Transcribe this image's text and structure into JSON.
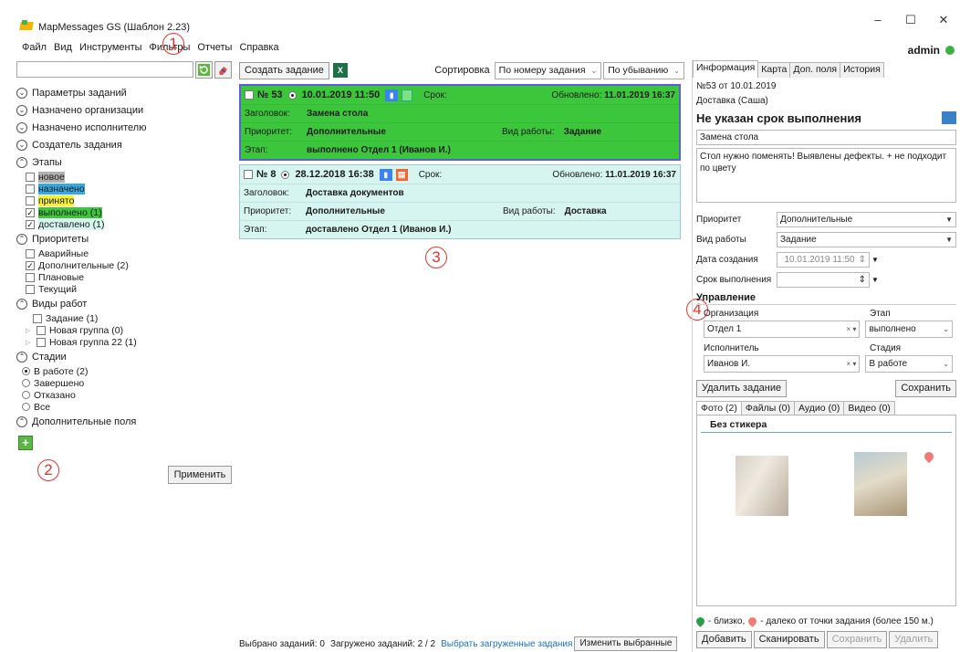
{
  "window": {
    "title": "MapMessages GS (Шаблон 2.23)",
    "min_glyph": "–",
    "max_glyph": "☐",
    "close_glyph": "✕"
  },
  "menu": [
    "Файл",
    "Вид",
    "Инструменты",
    "Фильтры",
    "Отчеты",
    "Справка"
  ],
  "user": {
    "name": "admin",
    "status_color": "#3cb043"
  },
  "markers": {
    "m1": "1",
    "m2": "2",
    "m3": "3",
    "m4": "4",
    "color": "#e0342b"
  },
  "left": {
    "search": {
      "value": "",
      "placeholder": ""
    },
    "sections": {
      "params": "Параметры заданий",
      "org": "Назначено организации",
      "executor": "Назначено исполнителю",
      "creator": "Создатель задания",
      "stages": "Этапы",
      "priorities": "Приоритеты",
      "work_types": "Виды работ",
      "phases": "Стадии",
      "extra": "Дополнительные поля"
    },
    "stages": [
      {
        "label": "новое",
        "checked": false,
        "highlight": "#b0b0b0"
      },
      {
        "label": "назначено",
        "checked": false,
        "highlight": "#36a9e1"
      },
      {
        "label": "принято",
        "checked": false,
        "highlight": "#f5f032"
      },
      {
        "label": "выполнено (1)",
        "checked": true,
        "highlight": "#3cc63c"
      },
      {
        "label": "доставлено (1)",
        "checked": true,
        "highlight": "#d6f5f0"
      }
    ],
    "priorities": [
      {
        "label": "Аварийные",
        "checked": false
      },
      {
        "label": "Дополнительные (2)",
        "checked": true
      },
      {
        "label": "Плановые",
        "checked": false
      },
      {
        "label": "Текущий",
        "checked": false
      }
    ],
    "work_types": [
      {
        "label": "Задание (1)"
      },
      {
        "label": "Новая группа (0)"
      },
      {
        "label": "Новая группа 22 (1)"
      }
    ],
    "phases": [
      {
        "label": "В работе (2)",
        "selected": true
      },
      {
        "label": "Завершено",
        "selected": false
      },
      {
        "label": "Отказано",
        "selected": false
      },
      {
        "label": "Все",
        "selected": false
      }
    ],
    "apply_label": "Применить"
  },
  "middle": {
    "create_label": "Создать задание",
    "excel_label": "X",
    "sort_label": "Сортировка",
    "sort_by": "По номеру задания",
    "sort_dir": "По убыванию",
    "cards": [
      {
        "num": "№ 53",
        "date": "10.01.2019 11:50",
        "srok": "Срок:",
        "updated_label": "Обновлено:",
        "updated": "11.01.2019 16:37",
        "title_label": "Заголовок:",
        "title": "Замена стола",
        "priority_label": "Приоритет:",
        "priority": "Дополнительные",
        "work_label": "Вид работы:",
        "work": "Задание",
        "stage_label": "Этап:",
        "stage": "выполнено Отдел 1 (Иванов И.)"
      },
      {
        "num": "№ 8",
        "date": "28.12.2018 16:38",
        "srok": "Срок:",
        "updated_label": "Обновлено:",
        "updated": "11.01.2019 16:37",
        "title_label": "Заголовок:",
        "title": "Доставка документов",
        "priority_label": "Приоритет:",
        "priority": "Дополнительные",
        "work_label": "Вид работы:",
        "work": "Доставка",
        "stage_label": "Этап:",
        "stage": "доставлено Отдел 1 (Иванов И.)"
      }
    ],
    "status": {
      "selected": "Выбрано заданий: 0",
      "loaded": "Загружено заданий: 2 / 2",
      "select_link": "Выбрать загруженные задания",
      "change_btn": "Изменить выбранные"
    }
  },
  "right": {
    "tabs": [
      "Информация",
      "Карта",
      "Доп. поля",
      "История"
    ],
    "task_line": "№53 от 10.01.2019",
    "delivery": "Доставка (Саша)",
    "headline": "Не указан срок выполнения",
    "title_value": "Замена стола",
    "description": "Стол нужно поменять! Выявлены дефекты. + не подходит по цвету",
    "priority_label": "Приоритет",
    "priority_value": "Дополнительные",
    "work_label": "Вид работы",
    "work_value": "Задание",
    "created_label": "Дата создания",
    "created_value": "10.01.2019 11:50",
    "due_label": "Срок выполнения",
    "due_value": "",
    "mgmt_title": "Управление",
    "org_label": "Организация",
    "org_value": "Отдел 1",
    "stage_label": "Этап",
    "stage_value": "выполнено",
    "exec_label": "Исполнитель",
    "exec_value": "Иванов И.",
    "phase_label": "Стадия",
    "phase_value": "В работе",
    "delete_label": "Удалить задание",
    "save_label": "Сохранить",
    "media_tabs": [
      "Фото (2)",
      "Файлы (0)",
      "Аудио (0)",
      "Видео (0)"
    ],
    "sticker_head": "Без стикера",
    "legend_near": "- близко,",
    "legend_far": "- далеко от точки задания (более 150 м.)",
    "add_label": "Добавить",
    "scan_label": "Сканировать",
    "save2_label": "Сохранить",
    "delete2_label": "Удалить"
  }
}
